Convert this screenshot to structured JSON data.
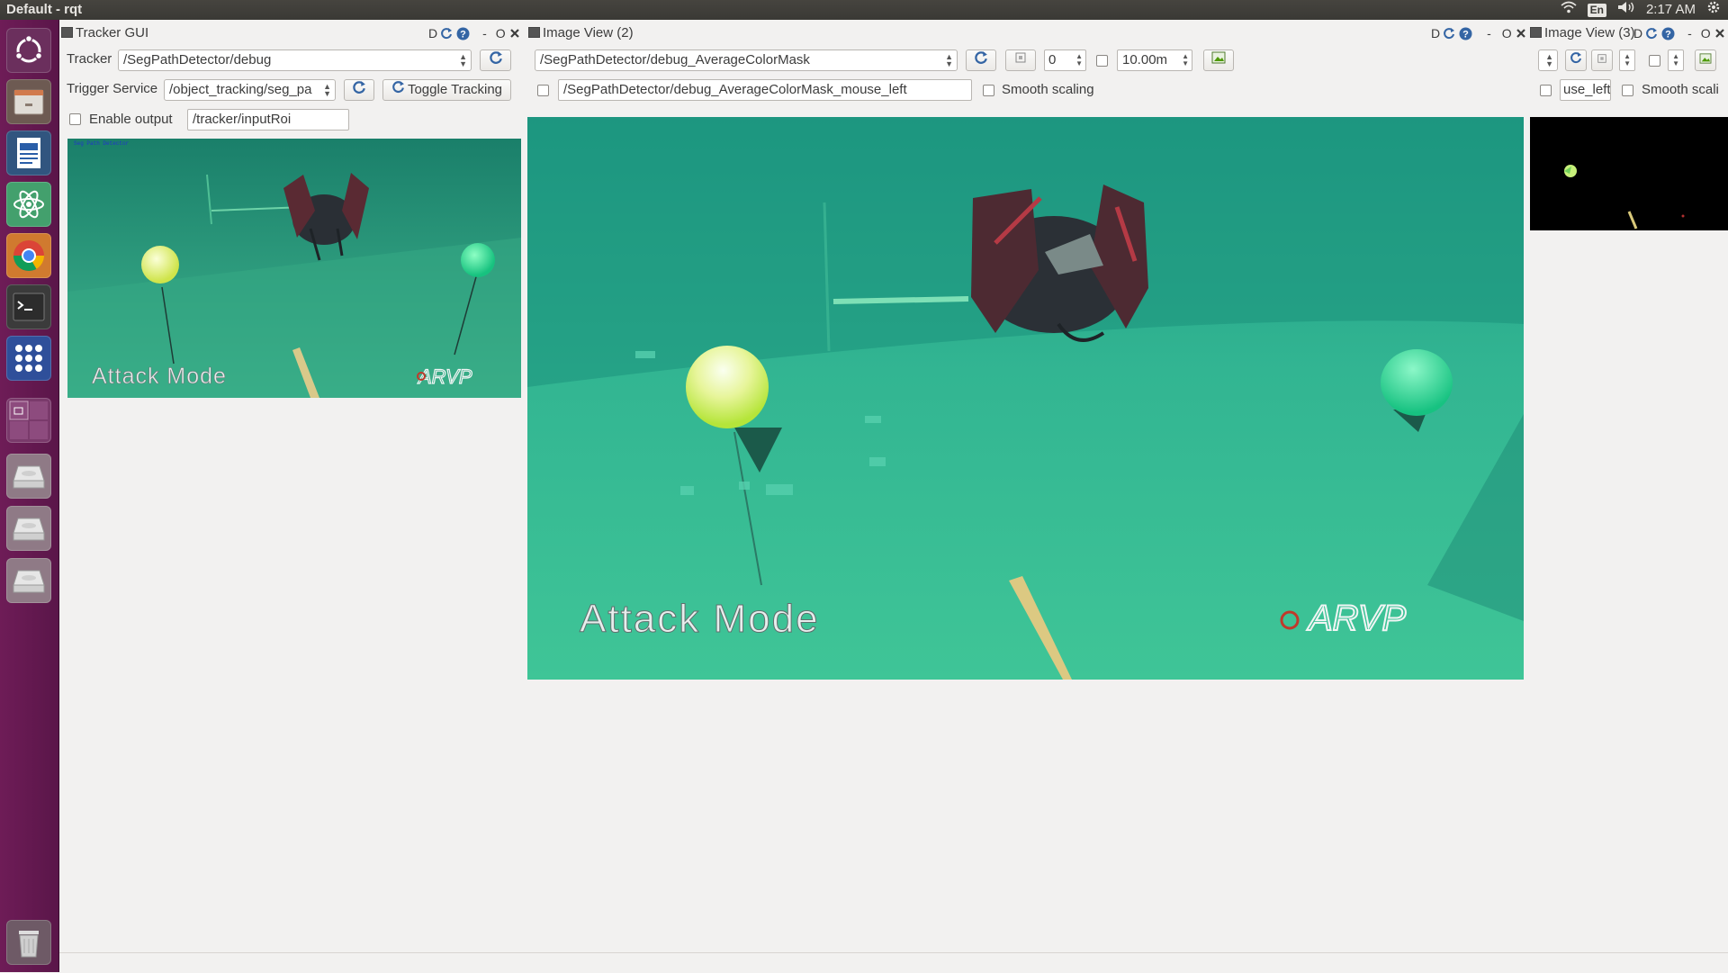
{
  "topbar": {
    "window_title": "Default - rqt",
    "lang": "En",
    "clock": "2:17 AM"
  },
  "launcher": {
    "items": [
      "ubuntu-logo-icon",
      "files-icon",
      "writer-icon",
      "atom-icon",
      "chrome-icon",
      "terminal-icon",
      "apps-grid-icon",
      "workspace-icon",
      "drive-icon",
      "drive-icon",
      "drive-icon",
      "trash-icon"
    ]
  },
  "tracker_gui": {
    "title": "Tracker GUI",
    "tracker_label": "Tracker",
    "tracker_value": "/SegPathDetector/debug",
    "trigger_label": "Trigger Service",
    "trigger_value": "/object_tracking/seg_pa",
    "toggle_label": "Toggle Tracking",
    "enable_output_label": "Enable output",
    "roi_value": "/tracker/inputRoi",
    "overlay_text": "Attack Mode",
    "logo_text": "ARVP",
    "small_caption": "Seg Path Detector"
  },
  "image_view_2": {
    "title": "Image View (2)",
    "topic_value": "/SegPathDetector/debug_AverageColorMask",
    "spin_value": "0",
    "timeout_value": "10.00m",
    "mouse_topic_value": "/SegPathDetector/debug_AverageColorMask_mouse_left",
    "smooth_label": "Smooth scaling",
    "overlay_text": "Attack Mode",
    "logo_text": "ARVP"
  },
  "image_view_3": {
    "title": "Image View (3)",
    "mouse_topic_value": "use_left",
    "smooth_label": "Smooth scali"
  },
  "dock_controls": {
    "d_label": "D",
    "float_label": "O"
  },
  "colors": {
    "launcher": "#6e1c57",
    "water_light": "#3cbf9a",
    "water_dark": "#1f8a77",
    "buoy_yellow": "#e6f27a",
    "buoy_green": "#2fe39a"
  }
}
